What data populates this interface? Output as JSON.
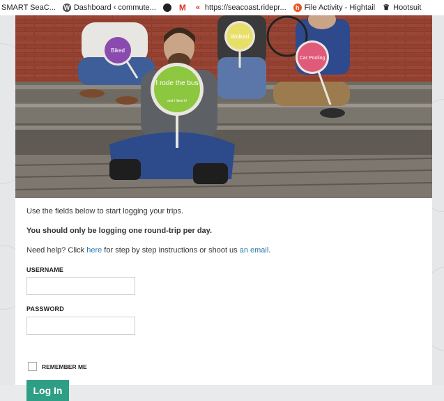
{
  "bookmarks": [
    {
      "label": "SMART SeaC...",
      "icon": "site-icon",
      "color": "#1f6fb4"
    },
    {
      "label": "Dashboard ‹ commute...",
      "icon": "wordpress-icon",
      "color": "#555555"
    },
    {
      "label": "",
      "icon": "circle-icon",
      "color": "#222222"
    },
    {
      "label": "",
      "icon": "gmail-icon",
      "color": "#d93025"
    },
    {
      "label": "https://seacoast.ridepr...",
      "icon": "link-icon",
      "color": "#d93025"
    },
    {
      "label": "File Activity - Hightail",
      "icon": "hightail-icon",
      "color": "#e8541e"
    },
    {
      "label": "Hootsuit",
      "icon": "hootsuite-icon",
      "color": "#222222"
    }
  ],
  "hero": {
    "sign_center": "I rode the bus",
    "sign_center_sub": "and I liked it!",
    "sign_left": "Biked",
    "sign_mid": "Walked",
    "sign_right": "Car Pooling"
  },
  "intro": {
    "line1": "Use the fields below to start logging your trips.",
    "line2": "You should only be logging one round-trip per day.",
    "help_prefix": "Need help? Click ",
    "help_link": "here",
    "help_mid": " for step by step instructions or shoot us ",
    "help_email": "an email",
    "help_suffix": "."
  },
  "form": {
    "username_label": "USERNAME",
    "username_value": "",
    "password_label": "PASSWORD",
    "password_value": "",
    "remember_label": "REMEMBER ME",
    "remember_checked": false,
    "submit_label": "Log In"
  },
  "colors": {
    "accent": "#2e9e84",
    "link": "#2a7ab0"
  }
}
